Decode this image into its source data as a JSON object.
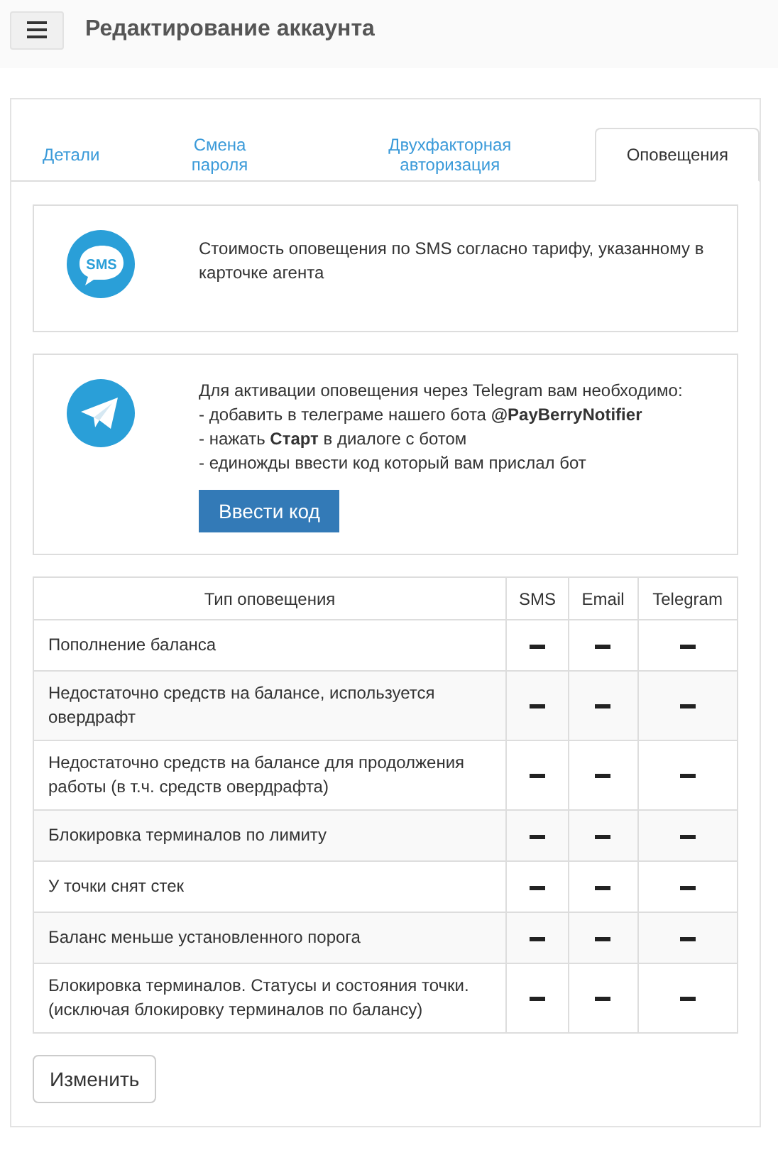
{
  "header": {
    "title": "Редактирование аккаунта"
  },
  "tabs": [
    {
      "label": "Детали",
      "selected": false
    },
    {
      "label": "Смена пароля",
      "selected": false
    },
    {
      "label": "Двухфакторная авторизация",
      "selected": false
    },
    {
      "label": "Оповещения",
      "selected": true
    }
  ],
  "info_boxes": [
    {
      "kind": "sms",
      "icon_text": "SMS",
      "lines": [
        "Стоимость оповещения по SMS согласно тарифу, указанному в карточке агента"
      ]
    },
    {
      "kind": "telegram",
      "lines": [
        "Для активации оповещения через Telegram вам необходимо:",
        " - добавить в телеграме нашего бота **@PayBerryNotifier**",
        " - нажать **Старт** в диалоге с ботом",
        " - единожды ввести код который вам прислал бот"
      ],
      "button": "Ввести код"
    }
  ],
  "table": {
    "columns": [
      "Тип оповещения",
      "SMS",
      "Email",
      "Telegram"
    ],
    "rows": [
      {
        "type": "Пополнение баланса",
        "sms": false,
        "email": false,
        "telegram": false
      },
      {
        "type": "Недостаточно средств на балансе, используется овердрафт",
        "sms": false,
        "email": false,
        "telegram": false
      },
      {
        "type": "Недостаточно средств на балансе для продолжения работы (в т.ч. средств овердрафта)",
        "sms": false,
        "email": false,
        "telegram": false
      },
      {
        "type": "Блокировка терминалов по лимиту",
        "sms": false,
        "email": false,
        "telegram": false
      },
      {
        "type": "У точки снят стек",
        "sms": false,
        "email": false,
        "telegram": false
      },
      {
        "type": "Баланс меньше установленного порога",
        "sms": false,
        "email": false,
        "telegram": false
      },
      {
        "type": "Блокировка терминалов. Статусы и состояния точки. (исключая блокировку терминалов по балансу)",
        "sms": false,
        "email": false,
        "telegram": false
      }
    ]
  },
  "edit_button": "Изменить"
}
